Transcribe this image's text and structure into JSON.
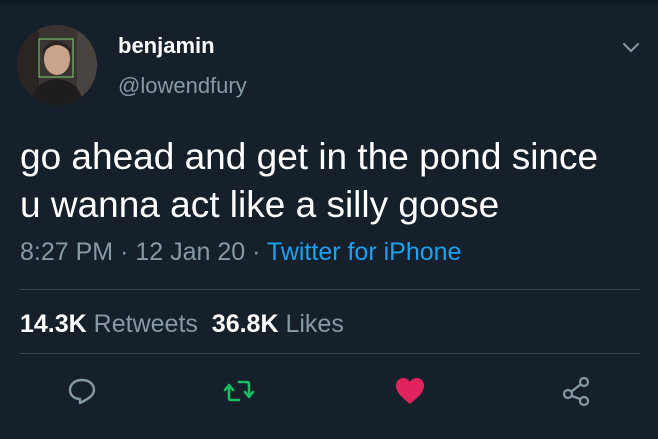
{
  "user": {
    "name": "benjamin",
    "handle": "@lowendfury"
  },
  "tweet": {
    "text_line1": "go ahead and get in the pond since",
    "text_line2": "u wanna act like a silly goose",
    "time": "8:27 PM",
    "sep1": " · ",
    "date": "12 Jan 20",
    "sep2": " · ",
    "source": "Twitter for iPhone"
  },
  "stats": {
    "retweets_count": "14.3K",
    "retweets_label": "Retweets",
    "likes_count": "36.8K",
    "likes_label": "Likes"
  },
  "icons": {
    "reply": "reply-icon",
    "retweet": "retweet-icon",
    "like": "heart-icon",
    "share": "share-icon",
    "menu": "chevron-down-icon"
  },
  "colors": {
    "background": "#15202b",
    "secondary_text": "#8899a6",
    "link": "#1da1f2",
    "retweet_active": "#17bf63",
    "like_active": "#e0245e"
  }
}
